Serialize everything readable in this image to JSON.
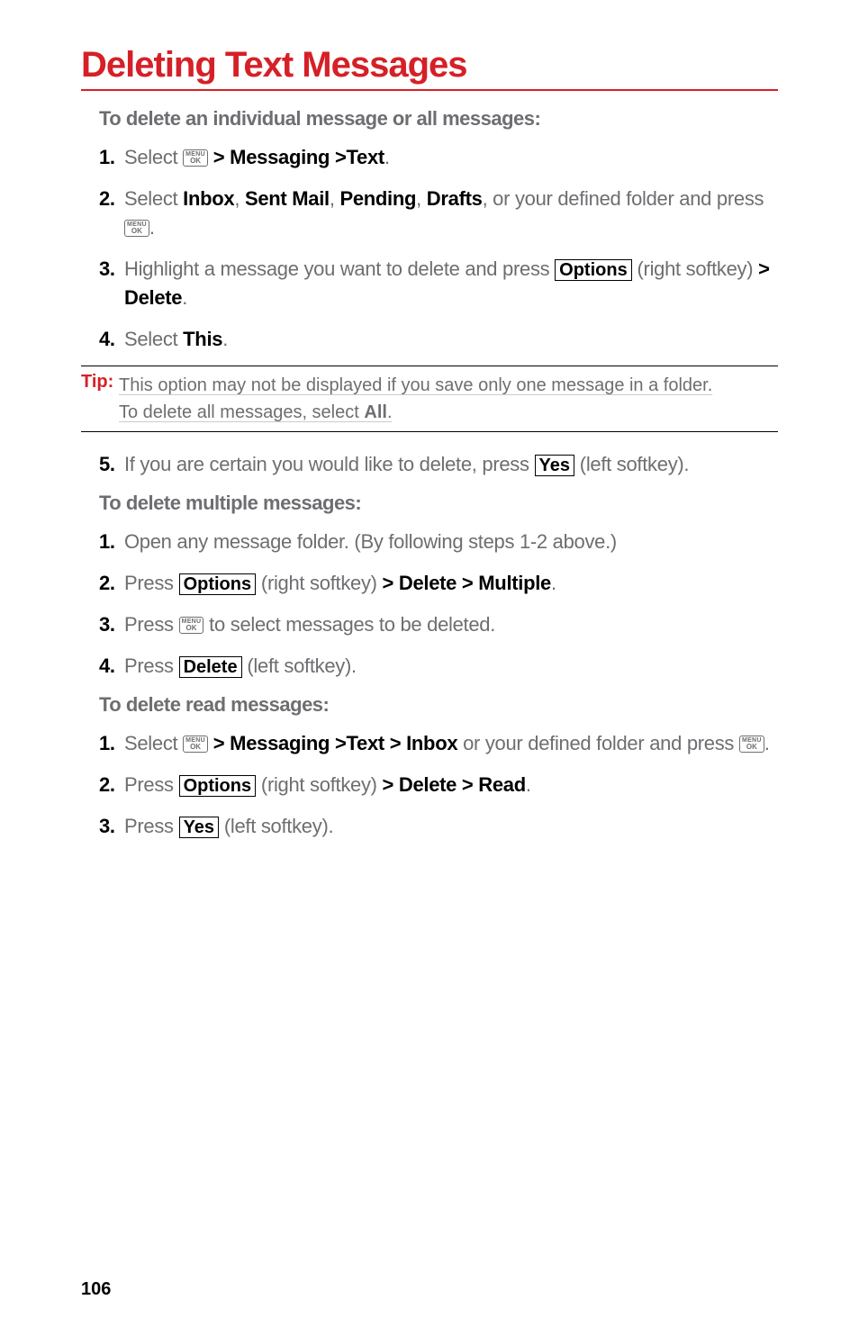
{
  "page": {
    "title": "Deleting Text Messages",
    "number": "106"
  },
  "section1": {
    "heading": "To delete an individual message or all messages:",
    "items": {
      "s1_pre": "Select ",
      "s1_post": " > ",
      "s1_b1": "Messaging >Text",
      "s1_end": ".",
      "s2_pre": "Select ",
      "s2_b1": "Inbox",
      "s2_c1": ", ",
      "s2_b2": "Sent Mail",
      "s2_c2": ", ",
      "s2_b3": "Pending",
      "s2_c3": ", ",
      "s2_b4": "Drafts",
      "s2_post": ", or your defined folder and press ",
      "s2_end": ".",
      "s3_pre": "Highlight a message you want to delete and press ",
      "s3_key": "Options",
      "s3_mid": " (right softkey) ",
      "s3_gt": "> ",
      "s3_b1": "Delete",
      "s3_end": ".",
      "s4_pre": "Select ",
      "s4_b1": "This",
      "s4_end": ".",
      "s5_pre": "If you are certain you would like to delete, press ",
      "s5_key": "Yes",
      "s5_post": " (left softkey)."
    }
  },
  "tip": {
    "label": "Tip:",
    "line1_a": "This option may not be displayed if you save only one message in a folder.",
    "line2_a": "To delete all messages, select ",
    "line2_b": "All",
    "line2_c": "."
  },
  "section2": {
    "heading": "To delete multiple messages:",
    "items": {
      "s1": "Open any message folder. (By following steps 1-2 above.)",
      "s2_pre": "Press ",
      "s2_key": "Options",
      "s2_mid": " (right softkey) ",
      "s2_gt": "> ",
      "s2_b1": "Delete > Multiple",
      "s2_end": ".",
      "s3_pre": "Press ",
      "s3_post": " to select messages to be deleted.",
      "s4_pre": "Press ",
      "s4_key": "Delete",
      "s4_post": " (left softkey)."
    }
  },
  "section3": {
    "heading": "To delete read messages:",
    "items": {
      "s1_pre": "Select ",
      "s1_mid": " > ",
      "s1_b1": "Messaging >Text > Inbox",
      "s1_post": " or your defined folder and press ",
      "s1_end": ".",
      "s2_pre": "Press ",
      "s2_key": "Options",
      "s2_mid": " (right softkey) ",
      "s2_gt": "> ",
      "s2_b1": "Delete > Read",
      "s2_end": ".",
      "s3_pre": "Press ",
      "s3_key": "Yes",
      "s3_post": " (left softkey)."
    }
  },
  "icons": {
    "menu_top": "MENU",
    "menu_bot": "OK"
  }
}
